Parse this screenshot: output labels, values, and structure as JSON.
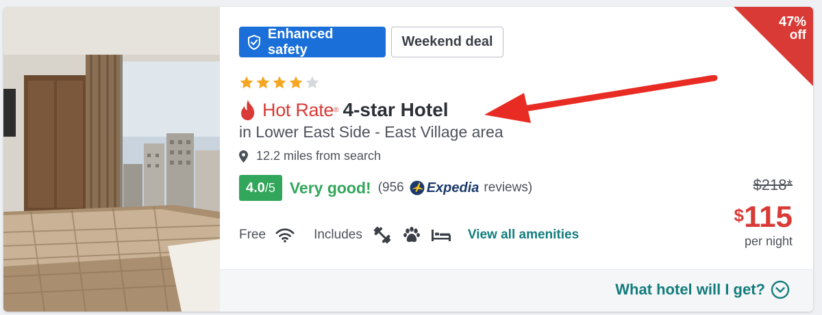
{
  "badges": {
    "safety_label": "Enhanced safety",
    "deal_label": "Weekend deal"
  },
  "hotel": {
    "star_rating": 4,
    "star_max": 5,
    "hot_rate_label": "Hot Rate",
    "reg_mark": "®",
    "type_label": "4-star Hotel",
    "area": "in Lower East Side - East Village area",
    "distance": "12.2 miles from search"
  },
  "rating": {
    "score": "4.0",
    "out_of": "/5",
    "word": "Very good!",
    "reviews_prefix": "(956",
    "provider": "Expedia",
    "reviews_suffix": "reviews)"
  },
  "amenities": {
    "free_label": "Free",
    "includes_label": "Includes",
    "view_all_label": "View all amenities",
    "free_icons": [
      "wifi-icon"
    ],
    "included_icons": [
      "dumbbell-icon",
      "paw-icon",
      "bed-icon"
    ]
  },
  "price": {
    "discount_percent": "47%",
    "discount_off": "off",
    "original": "$218*",
    "currency": "$",
    "amount": "115",
    "unit": "per night"
  },
  "footer": {
    "what_hotel_label": "What hotel will I get?"
  },
  "colors": {
    "primary_blue": "#1a6fd8",
    "hot_red": "#d93a36",
    "rating_green": "#32a65a",
    "teal_link": "#137c7c",
    "star_gold": "#f5a623",
    "arrow_red": "#e82c23"
  }
}
